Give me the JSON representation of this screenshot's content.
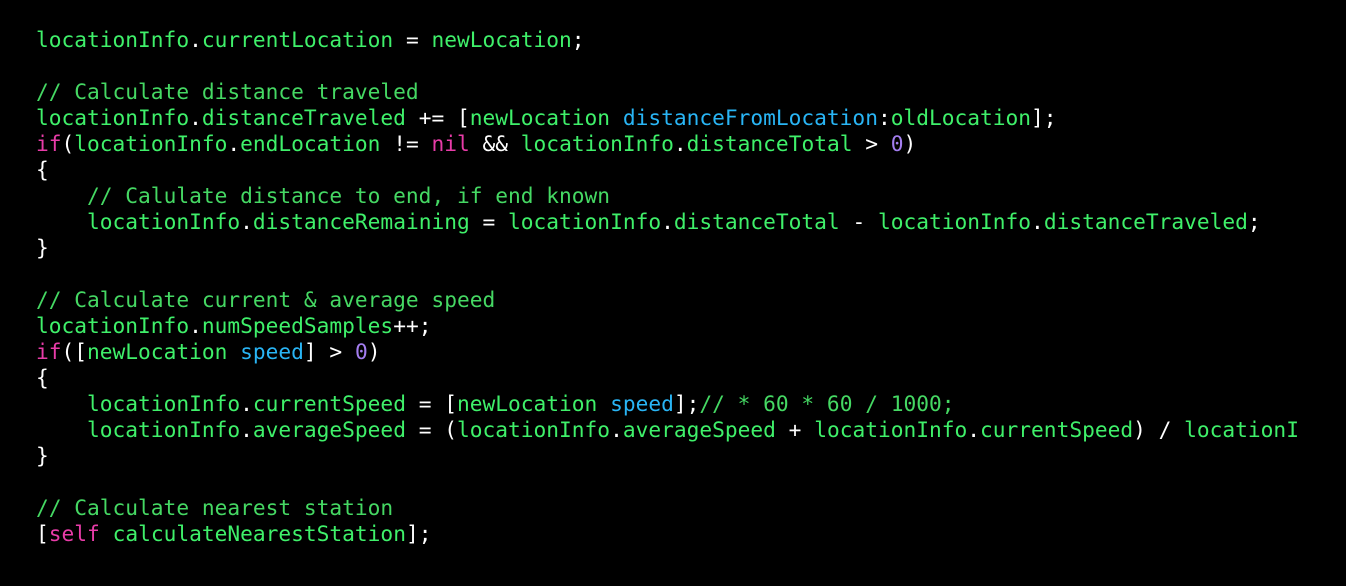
{
  "editor": {
    "theme": {
      "background": "#000000",
      "identifier": "#3ff06a",
      "comment": "#45d863",
      "keyword": "#e83ca8",
      "message": "#29b5f5",
      "number": "#a47ef0",
      "plain": "#ffffff"
    },
    "lines": [
      [
        {
          "c": "id",
          "t": "locationInfo"
        },
        {
          "c": "op",
          "t": "."
        },
        {
          "c": "id",
          "t": "currentLocation"
        },
        {
          "c": "op",
          "t": " = "
        },
        {
          "c": "id",
          "t": "newLocation"
        },
        {
          "c": "op",
          "t": ";"
        }
      ],
      [],
      [
        {
          "c": "cm",
          "t": "// Calculate distance traveled"
        }
      ],
      [
        {
          "c": "id",
          "t": "locationInfo"
        },
        {
          "c": "op",
          "t": "."
        },
        {
          "c": "id",
          "t": "distanceTraveled"
        },
        {
          "c": "op",
          "t": " += ["
        },
        {
          "c": "id",
          "t": "newLocation"
        },
        {
          "c": "op",
          "t": " "
        },
        {
          "c": "msg",
          "t": "distanceFromLocation"
        },
        {
          "c": "op",
          "t": ":"
        },
        {
          "c": "id",
          "t": "oldLocation"
        },
        {
          "c": "op",
          "t": "];"
        }
      ],
      [
        {
          "c": "kw",
          "t": "if"
        },
        {
          "c": "op",
          "t": "("
        },
        {
          "c": "id",
          "t": "locationInfo"
        },
        {
          "c": "op",
          "t": "."
        },
        {
          "c": "id",
          "t": "endLocation"
        },
        {
          "c": "op",
          "t": " != "
        },
        {
          "c": "kw",
          "t": "nil"
        },
        {
          "c": "op",
          "t": " && "
        },
        {
          "c": "id",
          "t": "locationInfo"
        },
        {
          "c": "op",
          "t": "."
        },
        {
          "c": "id",
          "t": "distanceTotal"
        },
        {
          "c": "op",
          "t": " > "
        },
        {
          "c": "num",
          "t": "0"
        },
        {
          "c": "op",
          "t": ")"
        }
      ],
      [
        {
          "c": "op",
          "t": "{"
        }
      ],
      [
        {
          "c": "op",
          "t": "    "
        },
        {
          "c": "cm",
          "t": "// Calulate distance to end, if end known"
        }
      ],
      [
        {
          "c": "op",
          "t": "    "
        },
        {
          "c": "id",
          "t": "locationInfo"
        },
        {
          "c": "op",
          "t": "."
        },
        {
          "c": "id",
          "t": "distanceRemaining"
        },
        {
          "c": "op",
          "t": " = "
        },
        {
          "c": "id",
          "t": "locationInfo"
        },
        {
          "c": "op",
          "t": "."
        },
        {
          "c": "id",
          "t": "distanceTotal"
        },
        {
          "c": "op",
          "t": " - "
        },
        {
          "c": "id",
          "t": "locationInfo"
        },
        {
          "c": "op",
          "t": "."
        },
        {
          "c": "id",
          "t": "distanceTraveled"
        },
        {
          "c": "op",
          "t": ";"
        }
      ],
      [
        {
          "c": "op",
          "t": "}"
        }
      ],
      [],
      [
        {
          "c": "cm",
          "t": "// Calculate current & average speed"
        }
      ],
      [
        {
          "c": "id",
          "t": "locationInfo"
        },
        {
          "c": "op",
          "t": "."
        },
        {
          "c": "id",
          "t": "numSpeedSamples"
        },
        {
          "c": "op",
          "t": "++;"
        }
      ],
      [
        {
          "c": "kw",
          "t": "if"
        },
        {
          "c": "op",
          "t": "(["
        },
        {
          "c": "id",
          "t": "newLocation"
        },
        {
          "c": "op",
          "t": " "
        },
        {
          "c": "msg",
          "t": "speed"
        },
        {
          "c": "op",
          "t": "] > "
        },
        {
          "c": "num",
          "t": "0"
        },
        {
          "c": "op",
          "t": ")"
        }
      ],
      [
        {
          "c": "op",
          "t": "{"
        }
      ],
      [
        {
          "c": "op",
          "t": "    "
        },
        {
          "c": "id",
          "t": "locationInfo"
        },
        {
          "c": "op",
          "t": "."
        },
        {
          "c": "id",
          "t": "currentSpeed"
        },
        {
          "c": "op",
          "t": " = ["
        },
        {
          "c": "id",
          "t": "newLocation"
        },
        {
          "c": "op",
          "t": " "
        },
        {
          "c": "msg",
          "t": "speed"
        },
        {
          "c": "op",
          "t": "];"
        },
        {
          "c": "cm",
          "t": "// * 60 * 60 / 1000;"
        }
      ],
      [
        {
          "c": "op",
          "t": "    "
        },
        {
          "c": "id",
          "t": "locationInfo"
        },
        {
          "c": "op",
          "t": "."
        },
        {
          "c": "id",
          "t": "averageSpeed"
        },
        {
          "c": "op",
          "t": " = ("
        },
        {
          "c": "id",
          "t": "locationInfo"
        },
        {
          "c": "op",
          "t": "."
        },
        {
          "c": "id",
          "t": "averageSpeed"
        },
        {
          "c": "op",
          "t": " + "
        },
        {
          "c": "id",
          "t": "locationInfo"
        },
        {
          "c": "op",
          "t": "."
        },
        {
          "c": "id",
          "t": "currentSpeed"
        },
        {
          "c": "op",
          "t": ") / "
        },
        {
          "c": "id",
          "t": "locationI"
        }
      ],
      [
        {
          "c": "op",
          "t": "}"
        }
      ],
      [],
      [
        {
          "c": "cm",
          "t": "// Calculate nearest station"
        }
      ],
      [
        {
          "c": "op",
          "t": "["
        },
        {
          "c": "kw",
          "t": "self"
        },
        {
          "c": "op",
          "t": " "
        },
        {
          "c": "id",
          "t": "calculateNearestStation"
        },
        {
          "c": "op",
          "t": "];"
        }
      ]
    ]
  }
}
